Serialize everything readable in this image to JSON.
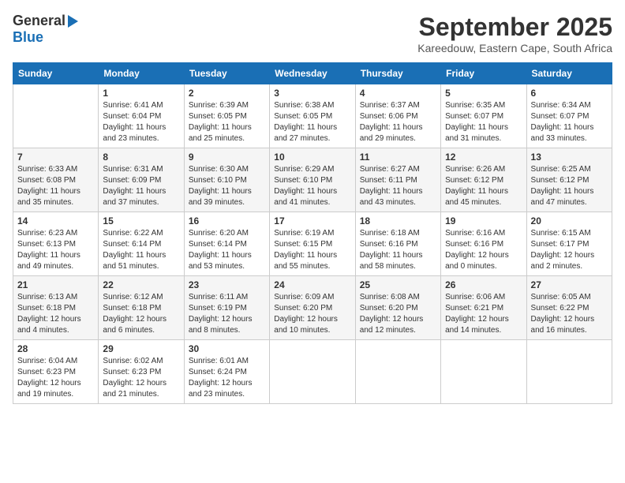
{
  "header": {
    "logo_general": "General",
    "logo_blue": "Blue",
    "title": "September 2025",
    "location": "Kareedouw, Eastern Cape, South Africa"
  },
  "calendar": {
    "days_of_week": [
      "Sunday",
      "Monday",
      "Tuesday",
      "Wednesday",
      "Thursday",
      "Friday",
      "Saturday"
    ],
    "weeks": [
      [
        {
          "day": "",
          "info": ""
        },
        {
          "day": "1",
          "info": "Sunrise: 6:41 AM\nSunset: 6:04 PM\nDaylight: 11 hours\nand 23 minutes."
        },
        {
          "day": "2",
          "info": "Sunrise: 6:39 AM\nSunset: 6:05 PM\nDaylight: 11 hours\nand 25 minutes."
        },
        {
          "day": "3",
          "info": "Sunrise: 6:38 AM\nSunset: 6:05 PM\nDaylight: 11 hours\nand 27 minutes."
        },
        {
          "day": "4",
          "info": "Sunrise: 6:37 AM\nSunset: 6:06 PM\nDaylight: 11 hours\nand 29 minutes."
        },
        {
          "day": "5",
          "info": "Sunrise: 6:35 AM\nSunset: 6:07 PM\nDaylight: 11 hours\nand 31 minutes."
        },
        {
          "day": "6",
          "info": "Sunrise: 6:34 AM\nSunset: 6:07 PM\nDaylight: 11 hours\nand 33 minutes."
        }
      ],
      [
        {
          "day": "7",
          "info": "Sunrise: 6:33 AM\nSunset: 6:08 PM\nDaylight: 11 hours\nand 35 minutes."
        },
        {
          "day": "8",
          "info": "Sunrise: 6:31 AM\nSunset: 6:09 PM\nDaylight: 11 hours\nand 37 minutes."
        },
        {
          "day": "9",
          "info": "Sunrise: 6:30 AM\nSunset: 6:10 PM\nDaylight: 11 hours\nand 39 minutes."
        },
        {
          "day": "10",
          "info": "Sunrise: 6:29 AM\nSunset: 6:10 PM\nDaylight: 11 hours\nand 41 minutes."
        },
        {
          "day": "11",
          "info": "Sunrise: 6:27 AM\nSunset: 6:11 PM\nDaylight: 11 hours\nand 43 minutes."
        },
        {
          "day": "12",
          "info": "Sunrise: 6:26 AM\nSunset: 6:12 PM\nDaylight: 11 hours\nand 45 minutes."
        },
        {
          "day": "13",
          "info": "Sunrise: 6:25 AM\nSunset: 6:12 PM\nDaylight: 11 hours\nand 47 minutes."
        }
      ],
      [
        {
          "day": "14",
          "info": "Sunrise: 6:23 AM\nSunset: 6:13 PM\nDaylight: 11 hours\nand 49 minutes."
        },
        {
          "day": "15",
          "info": "Sunrise: 6:22 AM\nSunset: 6:14 PM\nDaylight: 11 hours\nand 51 minutes."
        },
        {
          "day": "16",
          "info": "Sunrise: 6:20 AM\nSunset: 6:14 PM\nDaylight: 11 hours\nand 53 minutes."
        },
        {
          "day": "17",
          "info": "Sunrise: 6:19 AM\nSunset: 6:15 PM\nDaylight: 11 hours\nand 55 minutes."
        },
        {
          "day": "18",
          "info": "Sunrise: 6:18 AM\nSunset: 6:16 PM\nDaylight: 11 hours\nand 58 minutes."
        },
        {
          "day": "19",
          "info": "Sunrise: 6:16 AM\nSunset: 6:16 PM\nDaylight: 12 hours\nand 0 minutes."
        },
        {
          "day": "20",
          "info": "Sunrise: 6:15 AM\nSunset: 6:17 PM\nDaylight: 12 hours\nand 2 minutes."
        }
      ],
      [
        {
          "day": "21",
          "info": "Sunrise: 6:13 AM\nSunset: 6:18 PM\nDaylight: 12 hours\nand 4 minutes."
        },
        {
          "day": "22",
          "info": "Sunrise: 6:12 AM\nSunset: 6:18 PM\nDaylight: 12 hours\nand 6 minutes."
        },
        {
          "day": "23",
          "info": "Sunrise: 6:11 AM\nSunset: 6:19 PM\nDaylight: 12 hours\nand 8 minutes."
        },
        {
          "day": "24",
          "info": "Sunrise: 6:09 AM\nSunset: 6:20 PM\nDaylight: 12 hours\nand 10 minutes."
        },
        {
          "day": "25",
          "info": "Sunrise: 6:08 AM\nSunset: 6:20 PM\nDaylight: 12 hours\nand 12 minutes."
        },
        {
          "day": "26",
          "info": "Sunrise: 6:06 AM\nSunset: 6:21 PM\nDaylight: 12 hours\nand 14 minutes."
        },
        {
          "day": "27",
          "info": "Sunrise: 6:05 AM\nSunset: 6:22 PM\nDaylight: 12 hours\nand 16 minutes."
        }
      ],
      [
        {
          "day": "28",
          "info": "Sunrise: 6:04 AM\nSunset: 6:23 PM\nDaylight: 12 hours\nand 19 minutes."
        },
        {
          "day": "29",
          "info": "Sunrise: 6:02 AM\nSunset: 6:23 PM\nDaylight: 12 hours\nand 21 minutes."
        },
        {
          "day": "30",
          "info": "Sunrise: 6:01 AM\nSunset: 6:24 PM\nDaylight: 12 hours\nand 23 minutes."
        },
        {
          "day": "",
          "info": ""
        },
        {
          "day": "",
          "info": ""
        },
        {
          "day": "",
          "info": ""
        },
        {
          "day": "",
          "info": ""
        }
      ]
    ]
  }
}
